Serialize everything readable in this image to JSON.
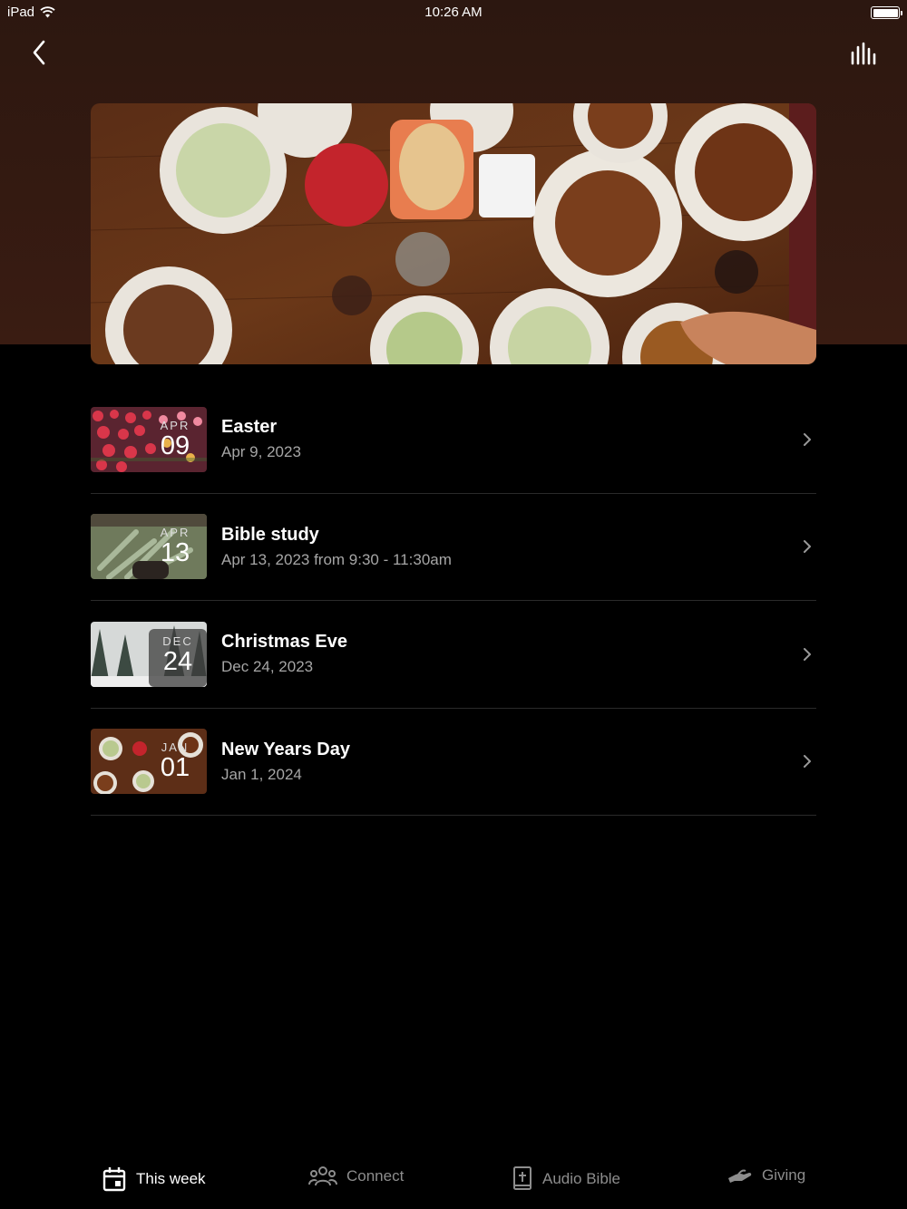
{
  "status": {
    "device": "iPad",
    "time": "10:26 AM"
  },
  "nav": {
    "back_icon": "chevron-left-icon",
    "menu_icon": "audio-bars-icon"
  },
  "hero": {
    "image": "dinner-table-food-photo"
  },
  "events": [
    {
      "month": "APR",
      "day": "09",
      "title": "Easter",
      "subtitle": "Apr 9, 2023",
      "thumb": "tulip-field"
    },
    {
      "month": "APR",
      "day": "13",
      "title": "Bible study",
      "subtitle": "Apr 13, 2023 from 9:30 - 11:30am",
      "thumb": "plant-hands"
    },
    {
      "month": "DEC",
      "day": "24",
      "title": "Christmas Eve",
      "subtitle": "Dec 24, 2023",
      "thumb": "snowy-forest"
    },
    {
      "month": "JAN",
      "day": "01",
      "title": "New Years Day",
      "subtitle": "Jan 1, 2024",
      "thumb": "food-table"
    }
  ],
  "tabs": [
    {
      "label": "This week",
      "icon": "calendar-icon",
      "active": true
    },
    {
      "label": "Connect",
      "icon": "people-icon",
      "active": false
    },
    {
      "label": "Audio Bible",
      "icon": "bible-icon",
      "active": false
    },
    {
      "label": "Giving",
      "icon": "giving-hand-icon",
      "active": false
    }
  ]
}
